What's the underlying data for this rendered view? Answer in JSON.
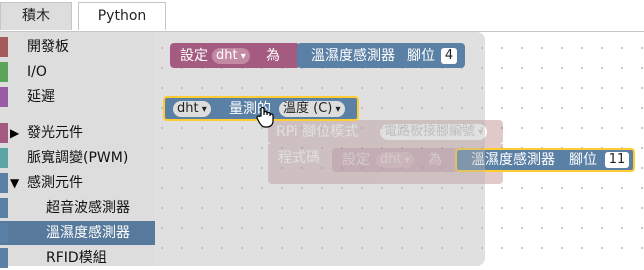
{
  "tabs": [
    {
      "label": "積木",
      "active": true
    },
    {
      "label": "Python",
      "active": false
    }
  ],
  "toolbox": {
    "items": [
      {
        "label": "開發板",
        "color": "#a55b5b",
        "expandable": false,
        "indent": false
      },
      {
        "label": "I/O",
        "color": "#5ba55b",
        "expandable": false,
        "indent": false
      },
      {
        "label": "延遲",
        "color": "#995ba5",
        "expandable": false,
        "indent": false
      },
      {
        "label": "發光元件",
        "color": "#a55b80",
        "expandable": true,
        "expanded": false,
        "arrow": "▶",
        "indent": false
      },
      {
        "label": "脈寬調變(PWM)",
        "color": "#5ba5a5",
        "expandable": false,
        "indent": false
      },
      {
        "label": "感測元件",
        "color": "#5b80a5",
        "expandable": true,
        "expanded": true,
        "arrow": "▼",
        "indent": false
      },
      {
        "label": "超音波感測器",
        "color": "#5b80a5",
        "expandable": false,
        "indent": true
      },
      {
        "label": "溫濕度感測器",
        "color": "#5b80a5",
        "expandable": false,
        "indent": true,
        "selected": true
      },
      {
        "label": "RFID模組",
        "color": "#5b80a5",
        "expandable": false,
        "indent": true
      }
    ]
  },
  "flyout": {
    "set_block": {
      "set_label": "設定",
      "var_name": "dht",
      "as_label": "為",
      "sensor_label": "溫濕度感測器",
      "pin_label": "腳位",
      "pin_value": "4"
    },
    "measure_block": {
      "var_name": "dht",
      "measured_label": "量測的",
      "measure_type": "溫度 (C)"
    }
  },
  "workspace": {
    "rpi_block": {
      "label": "RPi 腳位模式",
      "mode_value": "電路板接腳編號"
    },
    "code_block": {
      "label": "程式碼",
      "set_label": "設定",
      "var_name": "dht",
      "as_label": "為"
    },
    "sensor_block": {
      "sensor_label": "溫濕度感測器",
      "pin_label": "腳位",
      "pin_value": "11"
    }
  },
  "colors": {
    "variable_block": "#a55b80",
    "sensor_block": "#5b80a5",
    "rpi_block": "#a55b5b",
    "selection_highlight": "#fc3"
  }
}
